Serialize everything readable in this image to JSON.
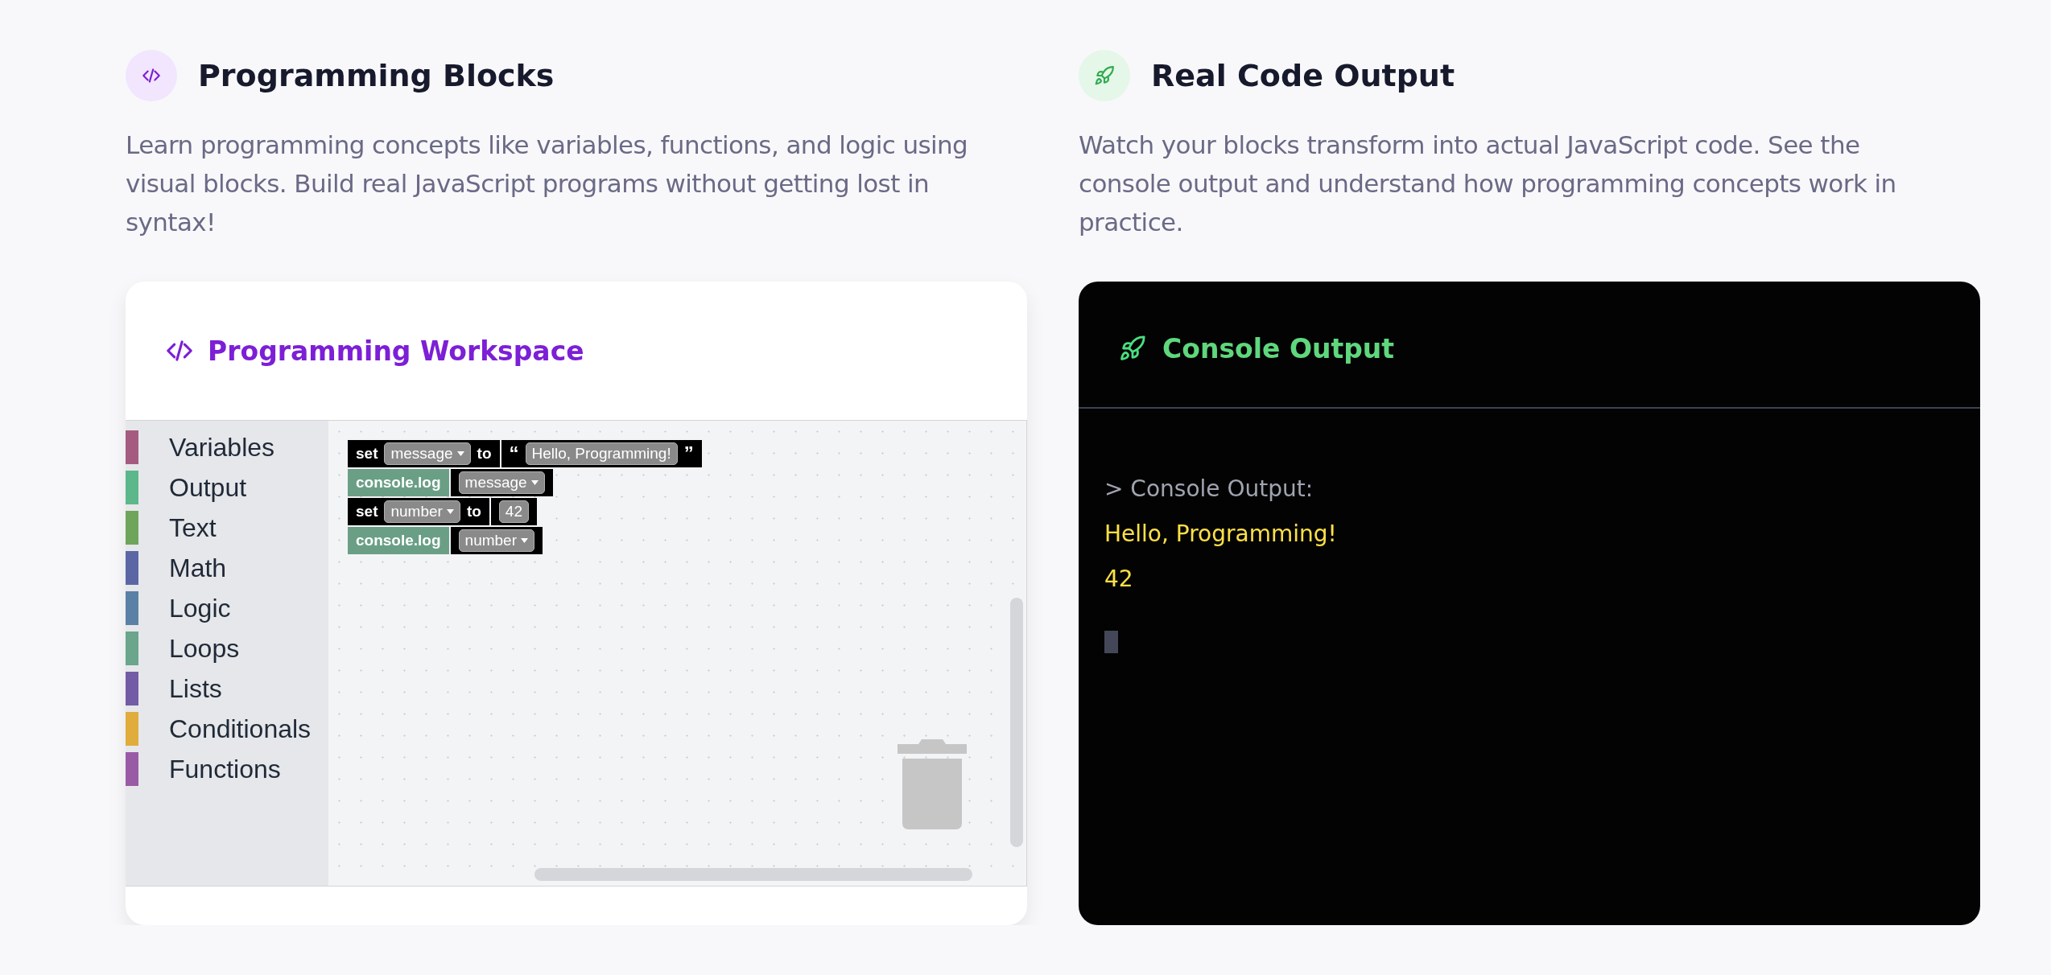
{
  "sections": [
    {
      "kind": "code",
      "title": "Programming Blocks",
      "description": "Learn programming concepts like variables, functions, and logic using visual blocks. Build real JavaScript programs without getting lost in syntax!"
    },
    {
      "kind": "rocket",
      "title": "Real Code Output",
      "description": "Watch your blocks transform into actual JavaScript code. See the console output and understand how programming concepts work in practice."
    }
  ],
  "workspace": {
    "title": "Programming Workspace",
    "categories": [
      {
        "label": "Variables",
        "color": "#a55b80"
      },
      {
        "label": "Output",
        "color": "#5cb88a"
      },
      {
        "label": "Text",
        "color": "#6ea55b"
      },
      {
        "label": "Math",
        "color": "#5b67a5"
      },
      {
        "label": "Logic",
        "color": "#5b80a5"
      },
      {
        "label": "Loops",
        "color": "#6aa58c"
      },
      {
        "label": "Lists",
        "color": "#745ba5"
      },
      {
        "label": "Conditionals",
        "color": "#e0ac3c"
      },
      {
        "label": "Functions",
        "color": "#995ba5"
      }
    ],
    "blocks": [
      {
        "segments": [
          {
            "color": "#000000",
            "parts": [
              {
                "kind": "keyword",
                "text": "set"
              },
              {
                "kind": "dropdown",
                "text": "message"
              },
              {
                "kind": "keyword",
                "text": "to"
              }
            ]
          },
          {
            "color": "#000000",
            "parts": [
              {
                "kind": "quote",
                "text": "“"
              },
              {
                "kind": "field",
                "text": "Hello, Programming!"
              },
              {
                "kind": "quote",
                "text": "”"
              }
            ]
          }
        ]
      },
      {
        "segments": [
          {
            "color": "#6a9f86",
            "parts": [
              {
                "kind": "keyword",
                "text": "console.log"
              }
            ]
          },
          {
            "color": "#000000",
            "parts": [
              {
                "kind": "dropdown",
                "text": "message"
              }
            ]
          }
        ]
      },
      {
        "segments": [
          {
            "color": "#000000",
            "parts": [
              {
                "kind": "keyword",
                "text": "set"
              },
              {
                "kind": "dropdown",
                "text": "number"
              },
              {
                "kind": "keyword",
                "text": "to"
              }
            ]
          },
          {
            "color": "#000000",
            "parts": [
              {
                "kind": "field",
                "text": "42"
              }
            ]
          }
        ]
      },
      {
        "segments": [
          {
            "color": "#6a9f86",
            "parts": [
              {
                "kind": "keyword",
                "text": "console.log"
              }
            ]
          },
          {
            "color": "#000000",
            "parts": [
              {
                "kind": "dropdown",
                "text": "number"
              }
            ]
          }
        ]
      }
    ]
  },
  "console": {
    "title": "Console Output",
    "lines": [
      {
        "kind": "prompt",
        "text": "> Console Output:"
      },
      {
        "kind": "output",
        "text": "Hello, Programming!"
      },
      {
        "kind": "output",
        "text": "42"
      }
    ]
  }
}
